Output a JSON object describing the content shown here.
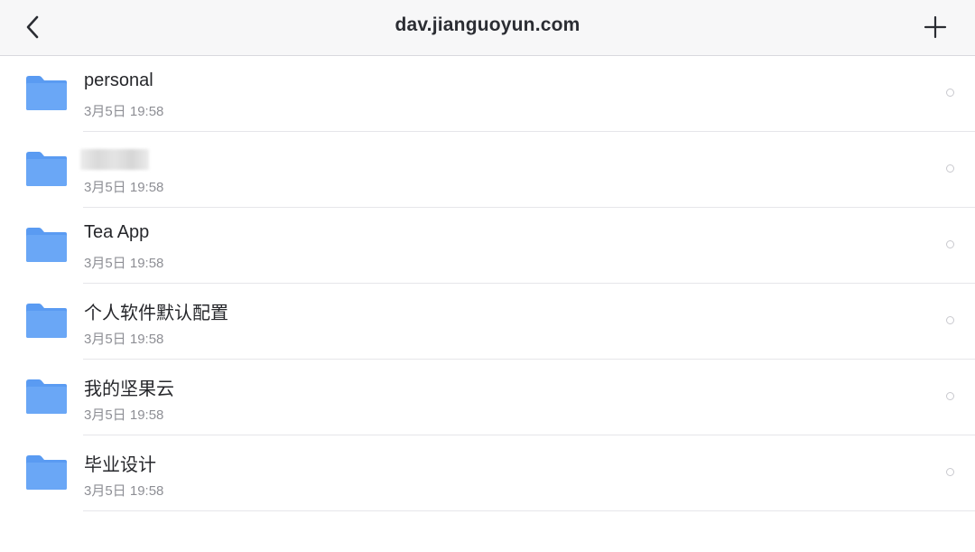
{
  "header": {
    "title": "dav.jianguoyun.com"
  },
  "colors": {
    "folder": "#6aa7f6",
    "folder_tab": "#5a9bf2",
    "header_bg": "#f7f7f8"
  },
  "files": [
    {
      "name": "personal",
      "time": "3月5日 19:58",
      "blurred": false
    },
    {
      "name": "",
      "time": "3月5日 19:58",
      "blurred": true
    },
    {
      "name": "Tea App",
      "time": "3月5日 19:58",
      "blurred": false
    },
    {
      "name": "个人软件默认配置",
      "time": "3月5日 19:58",
      "blurred": false
    },
    {
      "name": "我的坚果云",
      "time": "3月5日 19:58",
      "blurred": false
    },
    {
      "name": "毕业设计",
      "time": "3月5日 19:58",
      "blurred": false
    }
  ]
}
